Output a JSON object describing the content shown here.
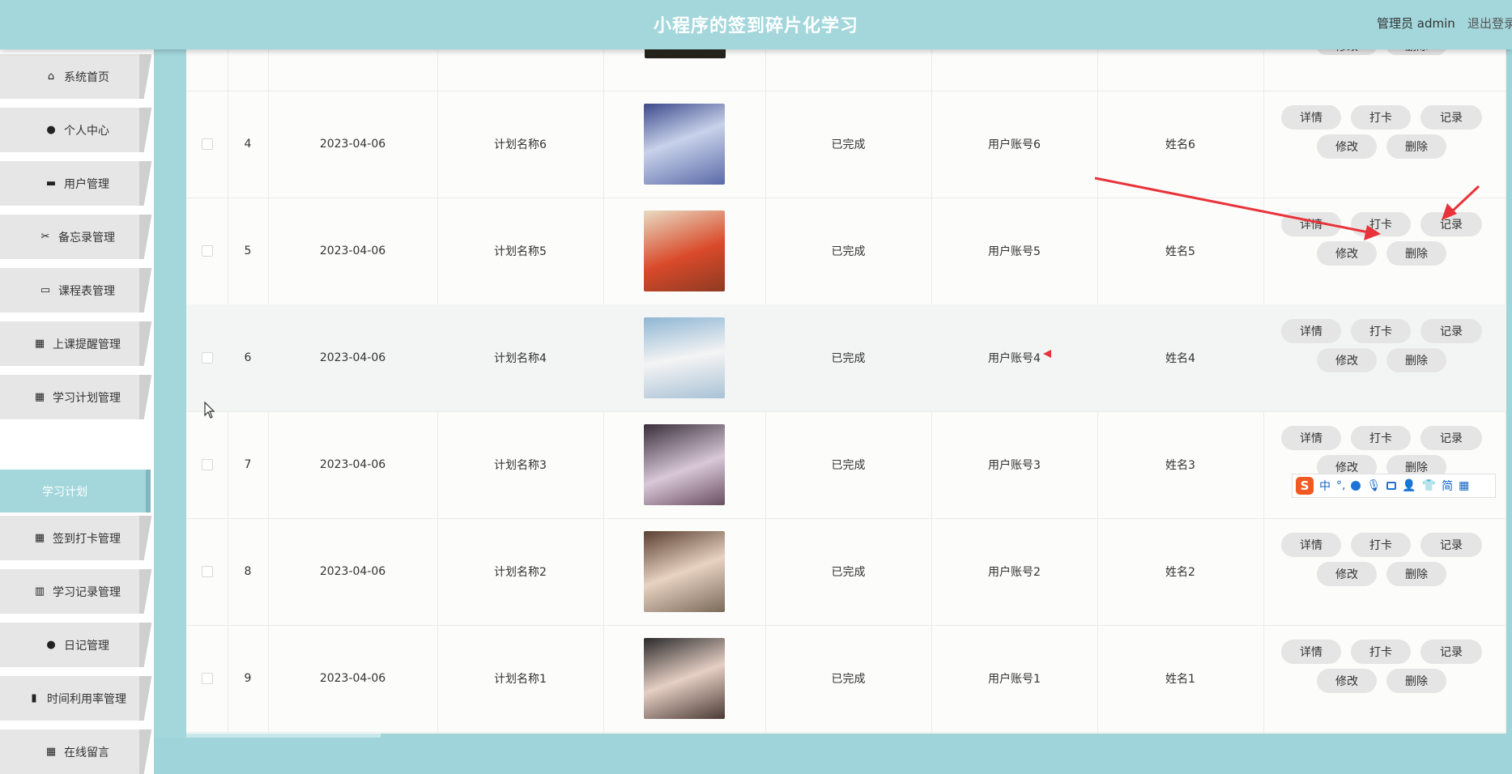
{
  "header": {
    "title": "小程序的签到碎片化学习",
    "user": "管理员 admin",
    "logout": "退出登录"
  },
  "sidebar": {
    "items": [
      {
        "label": "系统首页",
        "icon": "home-icon"
      },
      {
        "label": "个人中心",
        "icon": "user-icon"
      },
      {
        "label": "用户管理",
        "icon": "briefcase-icon"
      },
      {
        "label": "备忘录管理",
        "icon": "ticket-icon"
      },
      {
        "label": "课程表管理",
        "icon": "monitor-icon"
      },
      {
        "label": "上课提醒管理",
        "icon": "grid-icon"
      },
      {
        "label": "学习计划管理",
        "icon": "grid-icon"
      },
      {
        "label": "签到打卡管理",
        "icon": "grid-icon"
      },
      {
        "label": "学习记录管理",
        "icon": "books-icon"
      },
      {
        "label": "日记管理",
        "icon": "user-icon"
      },
      {
        "label": "时间利用率管理",
        "icon": "bar-chart-icon"
      },
      {
        "label": "在线留言",
        "icon": "grid-icon"
      }
    ],
    "active_sub": "学习计划"
  },
  "actions": {
    "detail": "详情",
    "punch": "打卡",
    "record": "记录",
    "edit": "修改",
    "delete": "删除"
  },
  "top_partial_row": {
    "actions": [
      "修改",
      "删除"
    ]
  },
  "table": {
    "rows": [
      {
        "index": "4",
        "date": "2023-04-06",
        "plan": "计划名称6",
        "status": "已完成",
        "account": "用户账号6",
        "name": "姓名6"
      },
      {
        "index": "5",
        "date": "2023-04-06",
        "plan": "计划名称5",
        "status": "已完成",
        "account": "用户账号5",
        "name": "姓名5"
      },
      {
        "index": "6",
        "date": "2023-04-06",
        "plan": "计划名称4",
        "status": "已完成",
        "account": "用户账号4",
        "name": "姓名4"
      },
      {
        "index": "7",
        "date": "2023-04-06",
        "plan": "计划名称3",
        "status": "已完成",
        "account": "用户账号3",
        "name": "姓名3"
      },
      {
        "index": "8",
        "date": "2023-04-06",
        "plan": "计划名称2",
        "status": "已完成",
        "account": "用户账号2",
        "name": "姓名2"
      },
      {
        "index": "9",
        "date": "2023-04-06",
        "plan": "计划名称1",
        "status": "已完成",
        "account": "用户账号1",
        "name": "姓名1"
      }
    ]
  },
  "ime_toolbar": {
    "label": "中",
    "punct": "°,",
    "simplified": "简"
  },
  "colors": {
    "accent": "#a3d7dc",
    "annotation": "#e8333a"
  }
}
